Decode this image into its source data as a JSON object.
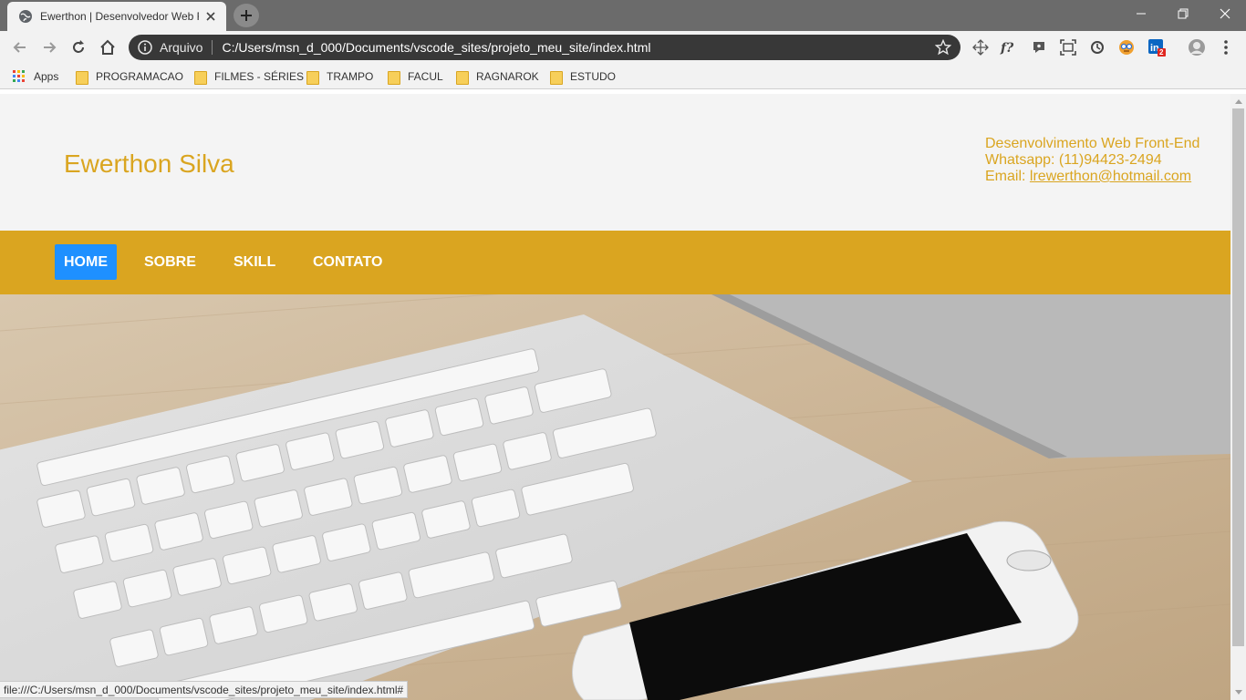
{
  "browser": {
    "tab_title": "Ewerthon | Desenvolvedor Web F",
    "omnibox": {
      "scheme_label": "Arquivo",
      "url": "C:/Users/msn_d_000/Documents/vscode_sites/projeto_meu_site/index.html"
    },
    "extension_badge": "2",
    "bookmarks": [
      {
        "label": "Apps",
        "icon": "apps-grid-icon"
      },
      {
        "label": "PROGRAMACAO",
        "icon": "folder-icon"
      },
      {
        "label": "FILMES - SÉRIES",
        "icon": "folder-icon"
      },
      {
        "label": "TRAMPO",
        "icon": "folder-icon"
      },
      {
        "label": "FACUL",
        "icon": "folder-icon"
      },
      {
        "label": "RAGNAROK",
        "icon": "folder-icon"
      },
      {
        "label": "ESTUDO",
        "icon": "folder-icon"
      }
    ],
    "status_url": "file:///C:/Users/msn_d_000/Documents/vscode_sites/projeto_meu_site/index.html#"
  },
  "page": {
    "brand": "Ewerthon Silva",
    "contact": {
      "line1": "Desenvolvimento Web Front-End",
      "line2": "Whatsapp: (11)94423-2494",
      "email_label": "Email: ",
      "email": "lrewerthon@hotmail.com"
    },
    "nav": [
      {
        "label": "HOME",
        "active": true
      },
      {
        "label": "SOBRE",
        "active": false
      },
      {
        "label": "SKILL",
        "active": false
      },
      {
        "label": "CONTATO",
        "active": false
      }
    ]
  },
  "colors": {
    "accent": "#daa520",
    "active_nav": "#1e90ff",
    "header_bg": "#f4f4f4"
  }
}
